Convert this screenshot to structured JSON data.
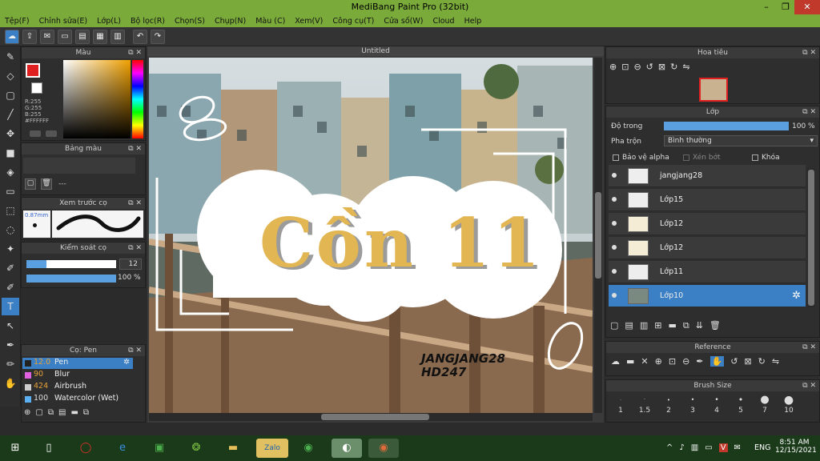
{
  "window": {
    "title": "MediBang Paint Pro (32bit)"
  },
  "menu": [
    "Tệp(F)",
    "Chỉnh sửa(E)",
    "Lớp(L)",
    "Bộ lọc(R)",
    "Chọn(S)",
    "Chụp(N)",
    "Màu (C)",
    "Xem(V)",
    "Công cụ(T)",
    "Cửa số(W)",
    "Cloud",
    "Help"
  ],
  "panels": {
    "color": {
      "title": "Màu",
      "r": "R:255",
      "g": "G:255",
      "b": "B:255",
      "hex": "#FFFFFF"
    },
    "palette": {
      "title": "Bảng màu",
      "dash": "---"
    },
    "brush_preview": {
      "title": "Xem trước cọ",
      "size": "0.87mm"
    },
    "brush_control": {
      "title": "Kiểm soát cọ",
      "size_value": "12",
      "opacity_value": "100 %"
    },
    "brush_list": {
      "title": "Cọ: Pen",
      "items": [
        {
          "size": "12.0",
          "name": "Pen"
        },
        {
          "size": "90",
          "name": "Blur"
        },
        {
          "size": "424",
          "name": "Airbrush"
        },
        {
          "size": "100",
          "name": "Watercolor (Wet)"
        }
      ]
    }
  },
  "document": {
    "tab": "Untitled"
  },
  "artwork": {
    "main_text": "Cồn 11",
    "signature_line1": "JANGJANG28",
    "signature_line2": "HD247"
  },
  "navigator": {
    "title": "Hoa tiêu"
  },
  "layers": {
    "title": "Lớp",
    "opacity_label": "Độ trong",
    "opacity_value": "100 %",
    "blend_label": "Pha trộn",
    "blend_value": "Bình thường",
    "protect_alpha": "Bảo vệ alpha",
    "clipping": "Xén bớt",
    "lock": "Khóa",
    "items": [
      "jangjang28",
      "Lớp15",
      "Lớp12",
      "Lớp12",
      "Lớp11",
      "Lớp10"
    ]
  },
  "reference": {
    "title": "Reference"
  },
  "brush_size": {
    "title": "Brush Size",
    "values": [
      "1",
      "1.5",
      "2",
      "3",
      "4",
      "5",
      "7",
      "10"
    ]
  },
  "taskbar": {
    "lang": "ENG",
    "time": "8:51 AM",
    "date": "12/15/2021"
  }
}
